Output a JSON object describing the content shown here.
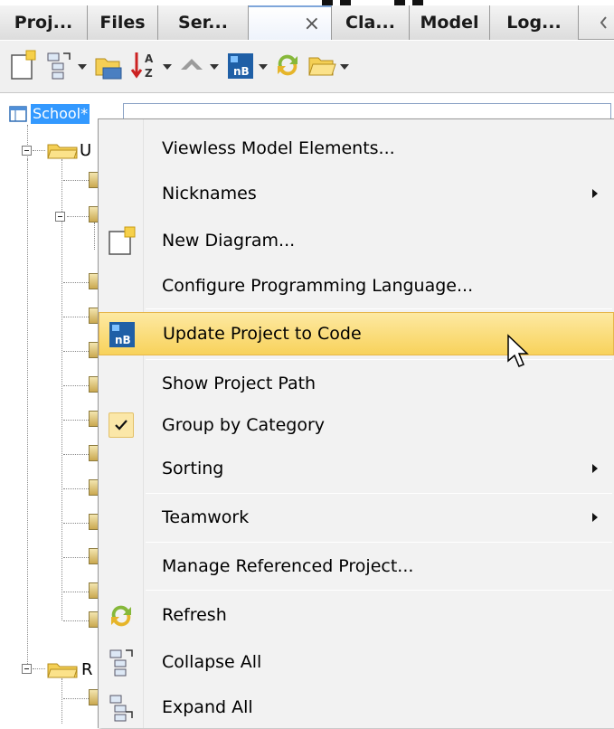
{
  "tabs": [
    {
      "label": "Proj...",
      "active": false
    },
    {
      "label": "Files",
      "active": false
    },
    {
      "label": "Ser...",
      "active": false
    },
    {
      "label": "",
      "active": true,
      "close": "×"
    },
    {
      "label": "Cla...",
      "active": false
    },
    {
      "label": "Model",
      "active": false
    },
    {
      "label": "Log...",
      "active": false
    }
  ],
  "toolbar": {
    "icons": [
      "new-diagram-icon",
      "collapse-tree-icon",
      "open-project-icon",
      "sort-az-icon",
      "navigate-up-icon",
      "update-code-icon",
      "refresh-icon",
      "folder-open-icon"
    ]
  },
  "tree": {
    "root_label": "School*",
    "child_1": "U",
    "child_2": "R"
  },
  "menu": {
    "items": [
      {
        "label": "Viewless Model Elements...",
        "submenu": false
      },
      {
        "label": "Nicknames",
        "submenu": true
      },
      {
        "label": "New Diagram...",
        "submenu": false,
        "icon": "new-diagram-icon"
      },
      {
        "label": "Configure Programming Language...",
        "submenu": false
      },
      {
        "label": "Update Project to Code",
        "submenu": false,
        "icon": "update-code-icon",
        "highlighted": true
      },
      {
        "label": "Show Project Path",
        "submenu": false
      },
      {
        "label": "Group by Category",
        "submenu": false,
        "checked": true
      },
      {
        "label": "Sorting",
        "submenu": true
      },
      {
        "label": "Teamwork",
        "submenu": true
      },
      {
        "label": "Manage Referenced Project...",
        "submenu": false
      },
      {
        "label": "Refresh",
        "submenu": false,
        "icon": "refresh-icon"
      },
      {
        "label": "Collapse All",
        "submenu": false,
        "icon": "collapse-all-icon"
      },
      {
        "label": "Expand All",
        "submenu": false,
        "icon": "expand-all-icon"
      }
    ]
  },
  "colors": {
    "selection": "#3399ff",
    "highlight": "#f8d25b",
    "menu_bg": "#f2f2f2"
  }
}
